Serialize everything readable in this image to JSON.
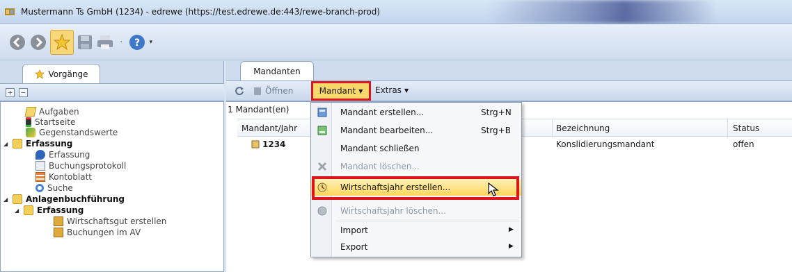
{
  "window": {
    "title": "Mustermann Ts GmbH (1234) - edrewe (https://test.edrewe.de:443/rewe-branch-prod)"
  },
  "toolbar": {
    "icons": [
      "back-icon",
      "forward-icon",
      "favorites-star-icon",
      "save-icon",
      "print-icon",
      "help-icon"
    ]
  },
  "left_panel": {
    "tab_label": "Vorgänge",
    "expand_all": "+",
    "collapse_all": "−",
    "tree": [
      {
        "label": "Aufgaben",
        "bold": false
      },
      {
        "label": "Startseite",
        "bold": false
      },
      {
        "label": "Gegenstandswerte",
        "bold": false
      },
      {
        "label": "Erfassung",
        "bold": true
      },
      {
        "label": "Erfassung",
        "bold": false
      },
      {
        "label": "Buchungsprotokoll",
        "bold": false
      },
      {
        "label": "Kontoblatt",
        "bold": false
      },
      {
        "label": "Suche",
        "bold": false
      },
      {
        "label": "Anlagenbuchführung",
        "bold": true
      },
      {
        "label": "Erfassung",
        "bold": true
      },
      {
        "label": "Wirtschaftsgut erstellen",
        "bold": false
      },
      {
        "label": "Buchungen im AV",
        "bold": false
      }
    ]
  },
  "main": {
    "tab_label": "Mandanten",
    "actions": {
      "open": "Öffnen",
      "mandant_menu": "Mandant",
      "extras_menu": "Extras"
    },
    "grid": {
      "count": "1 Mandant(en)",
      "columns": [
        "Mandant/Jahr",
        "Bezeichnung",
        "Status"
      ],
      "rows": [
        {
          "mandant": "1234",
          "bezeichnung": "Konslidierungsmandant",
          "status": "offen"
        }
      ]
    }
  },
  "dropdown": {
    "items": [
      {
        "label": "Mandant erstellen...",
        "shortcut": "Strg+N",
        "icon": "mandant-create-icon",
        "disabled": false
      },
      {
        "label": "Mandant bearbeiten...",
        "shortcut": "Strg+B",
        "icon": "mandant-edit-icon",
        "disabled": false
      },
      {
        "label": "Mandant schließen",
        "shortcut": "",
        "icon": "",
        "disabled": false
      },
      {
        "label": "Mandant löschen...",
        "shortcut": "",
        "icon": "delete-icon",
        "disabled": true
      },
      {
        "label": "Wirtschaftsjahr erstellen...",
        "shortcut": "",
        "icon": "year-create-icon",
        "disabled": false,
        "highlighted": true
      },
      {
        "label": "Wirtschaftsjahr löschen...",
        "shortcut": "",
        "icon": "year-delete-icon",
        "disabled": true
      },
      {
        "label": "Import",
        "submenu": true
      },
      {
        "label": "Export",
        "submenu": true
      }
    ]
  },
  "colors": {
    "highlight_frame": "#e0141b",
    "menu_highlight": "#ffd65a"
  }
}
